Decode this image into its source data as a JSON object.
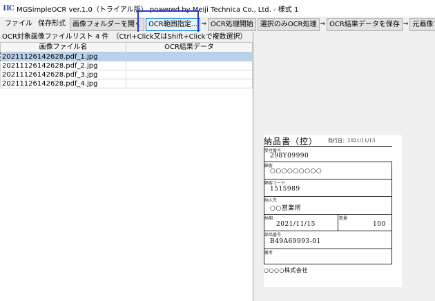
{
  "window": {
    "title": "MGSimpleOCR ver.1.0（トライアル版） powered by Meiji Technica Co., Ltd. - 様式 1"
  },
  "menu": {
    "file": "ファイル",
    "save_format": "保存形式"
  },
  "toolbar": {
    "open_folder": "画像フォルダーを開く",
    "ocr_range": "OCR範囲指定...",
    "ocr_start": "OCR処理開始",
    "ocr_selected": "選択のみOCR処理",
    "save_result": "OCR結果データを保存",
    "original_image": "元画像ファイ",
    "arrow": "⇒"
  },
  "file_list": {
    "status": "OCR対象画像ファイルリスト 4 件　（Ctrl+Click又はShift+Clickで複数選択）",
    "columns": [
      "画像ファイル名",
      "OCR結果データ"
    ],
    "rows": [
      {
        "name": "20211126142628.pdf_1.jpg",
        "result": ""
      },
      {
        "name": "20211126142628.pdf_2.jpg",
        "result": ""
      },
      {
        "name": "20211126142628.pdf_3.jpg",
        "result": ""
      },
      {
        "name": "20211126142628.pdf_4.jpg",
        "result": ""
      }
    ]
  },
  "preview": {
    "title": "納品書（控）",
    "date": "発行日：2021/11/13",
    "labels": {
      "receipt_no": "受付番号",
      "customer": "顧客",
      "code": "顧客コード",
      "dept": "納入先",
      "date": "納期",
      "qty": "数量",
      "part_no": "部品番号",
      "remarks": "備考"
    },
    "values": {
      "receipt_no": "298Y09990",
      "customer": "○○○○○○○○○",
      "code": "1515989",
      "dept": "○○営業所",
      "date": "2021/11/15",
      "qty": "100",
      "part_no": "B49A69993-01"
    },
    "footer": "○○○○株式会社"
  }
}
